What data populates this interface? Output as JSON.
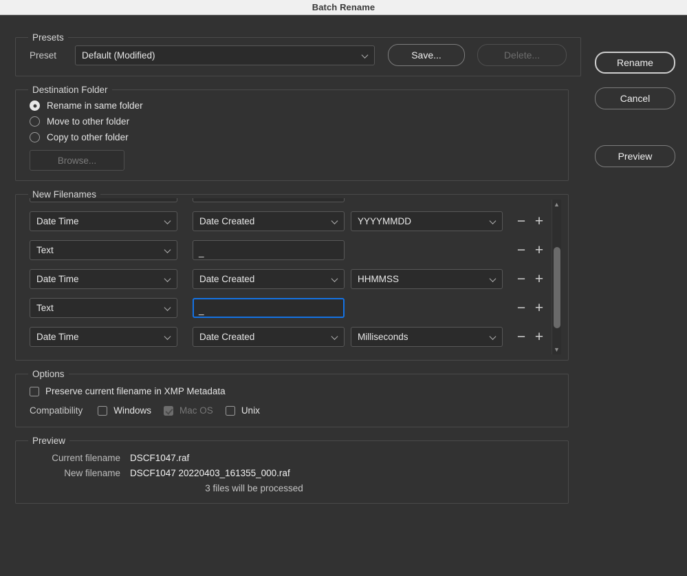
{
  "window": {
    "title": "Batch Rename"
  },
  "presets": {
    "legend": "Presets",
    "preset_label": "Preset",
    "preset_value": "Default (Modified)",
    "save_label": "Save...",
    "delete_label": "Delete..."
  },
  "destination": {
    "legend": "Destination Folder",
    "options": [
      {
        "label": "Rename in same folder",
        "selected": true
      },
      {
        "label": "Move to other folder",
        "selected": false
      },
      {
        "label": "Copy to other folder",
        "selected": false
      }
    ],
    "browse_label": "Browse..."
  },
  "new_filenames": {
    "legend": "New Filenames",
    "rows": [
      {
        "type": "",
        "source": "",
        "format": "",
        "partial": true
      },
      {
        "type": "Date Time",
        "source": "Date Created",
        "format": "YYYYMMDD",
        "has_format": true
      },
      {
        "type": "Text",
        "text_value": "_",
        "has_format": false,
        "focused": false
      },
      {
        "type": "Date Time",
        "source": "Date Created",
        "format": "HHMMSS",
        "has_format": true
      },
      {
        "type": "Text",
        "text_value": "_",
        "has_format": false,
        "focused": true
      },
      {
        "type": "Date Time",
        "source": "Date Created",
        "format": "Milliseconds",
        "has_format": true
      }
    ],
    "remove_glyph": "−",
    "add_glyph": "+"
  },
  "options": {
    "legend": "Options",
    "preserve_label": "Preserve current filename in XMP Metadata",
    "preserve_checked": false,
    "compatibility_label": "Compatibility",
    "compat": [
      {
        "label": "Windows",
        "checked": false,
        "disabled": false
      },
      {
        "label": "Mac OS",
        "checked": true,
        "disabled": true
      },
      {
        "label": "Unix",
        "checked": false,
        "disabled": false
      }
    ]
  },
  "preview": {
    "legend": "Preview",
    "current_label": "Current filename",
    "current_value": "DSCF1047.raf",
    "new_label": "New filename",
    "new_value": "DSCF1047 20220403_161355_000.raf",
    "note": "3 files will be processed"
  },
  "actions": {
    "rename_label": "Rename",
    "cancel_label": "Cancel",
    "preview_label": "Preview"
  },
  "colors": {
    "panel_bg": "#323232",
    "field_bg": "#2b2b2b",
    "focus_blue": "#1473e6",
    "titlebar_bg": "#f0f0f0"
  }
}
